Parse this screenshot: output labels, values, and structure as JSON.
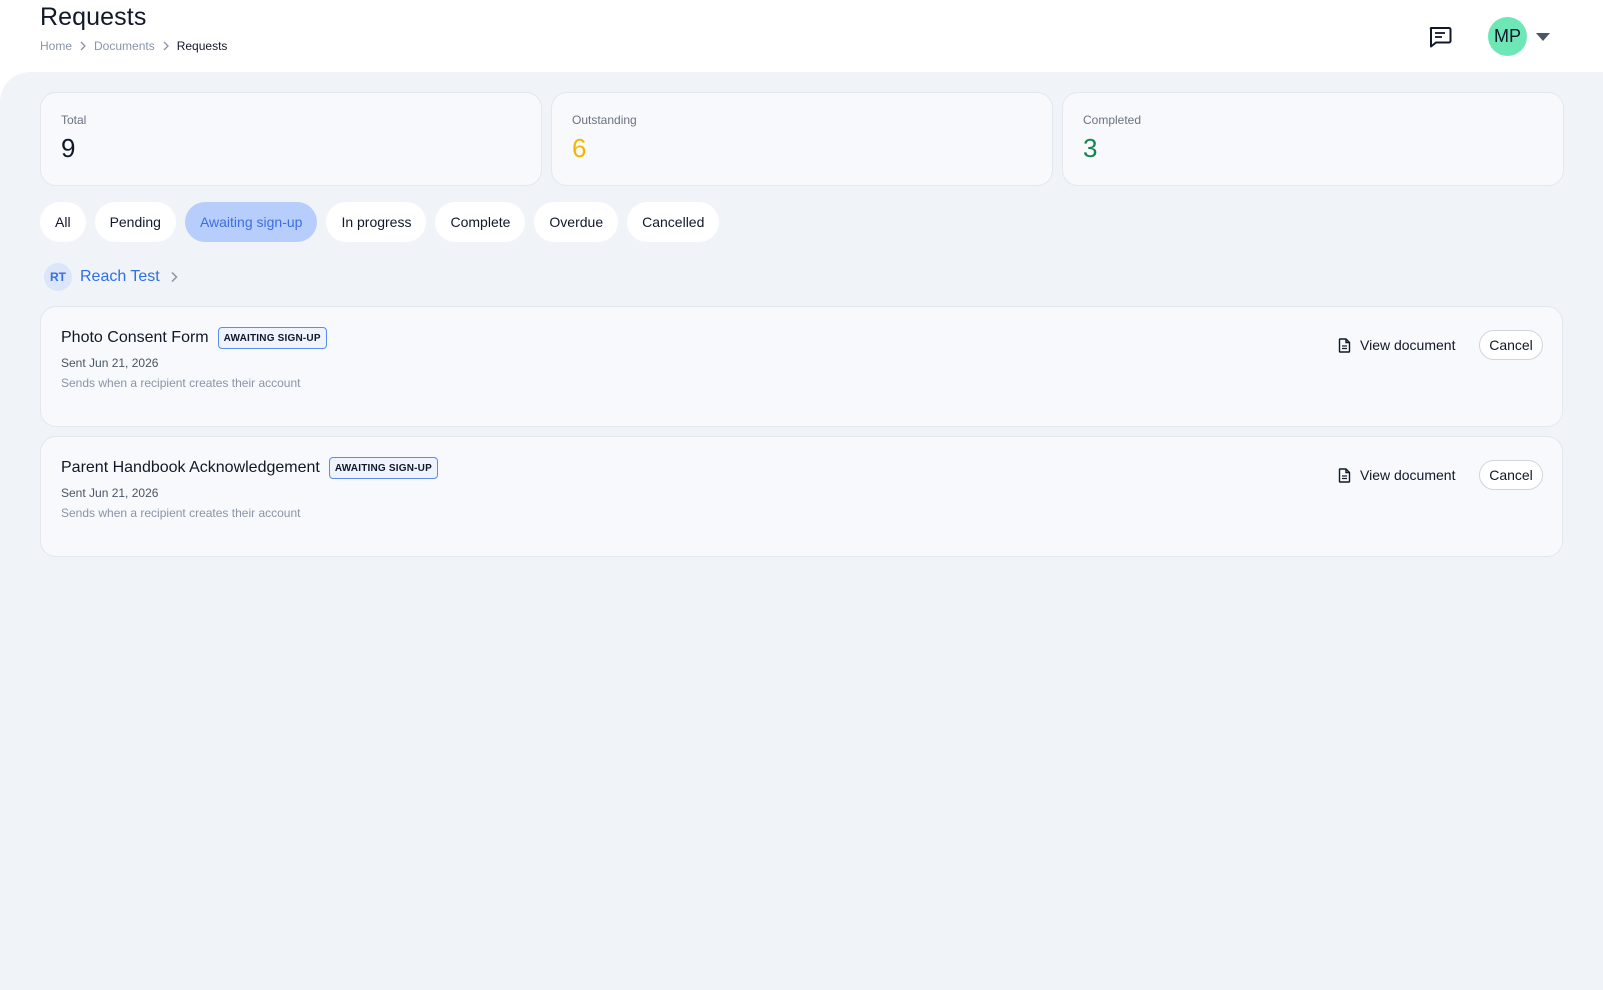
{
  "header": {
    "title": "Requests",
    "breadcrumb": [
      "Home",
      "Documents",
      "Requests"
    ],
    "user_initials": "MP"
  },
  "stats": [
    {
      "label": "Total",
      "value": "9",
      "color": "#111827"
    },
    {
      "label": "Outstanding",
      "value": "6",
      "color": "#f2b705"
    },
    {
      "label": "Completed",
      "value": "3",
      "color": "#15834f"
    }
  ],
  "filters": [
    "All",
    "Pending",
    "Awaiting sign-up",
    "In progress",
    "Complete",
    "Overdue",
    "Cancelled"
  ],
  "active_filter": "Awaiting sign-up",
  "group": {
    "initials": "RT",
    "name": "Reach Test"
  },
  "requests": [
    {
      "title": "Photo Consent Form",
      "status": "AWAITING SIGN-UP",
      "sent": "Sent Jun 21, 2026",
      "note": "Sends when a recipient creates their account",
      "view_label": "View document",
      "cancel_label": "Cancel"
    },
    {
      "title": "Parent Handbook Acknowledgement",
      "status": "AWAITING SIGN-UP",
      "sent": "Sent Jun 21, 2026",
      "note": "Sends when a recipient creates their account",
      "view_label": "View document",
      "cancel_label": "Cancel"
    }
  ],
  "icons": {
    "chat": "message-square-icon",
    "caret": "caret-down-icon",
    "chevron": "chevron-right-icon",
    "document": "file-text-icon"
  }
}
